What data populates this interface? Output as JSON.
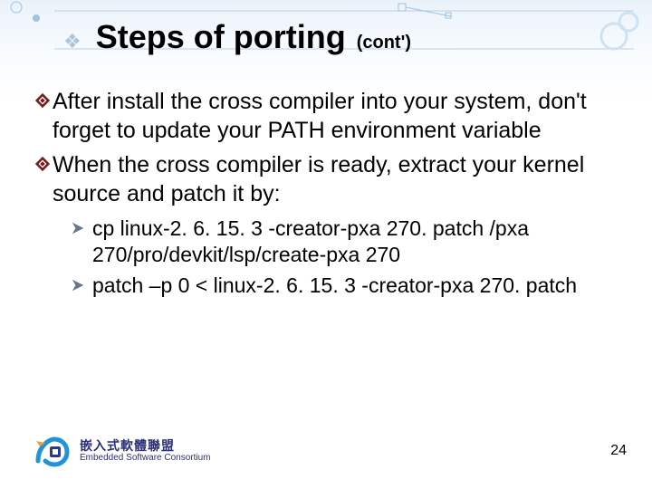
{
  "title": {
    "main": "Steps of porting",
    "suffix": "(cont')"
  },
  "bullets": [
    {
      "text": "After install the cross compiler into your system, don't forget to update your PATH environment variable"
    },
    {
      "text": "When the cross compiler is ready, extract your kernel source and patch it by:"
    }
  ],
  "sub_bullets": [
    {
      "text": "cp  linux-2. 6. 15. 3 -creator-pxa 270. patch /pxa 270/pro/devkit/lsp/create-pxa 270"
    },
    {
      "text": "patch –p 0 < linux-2. 6. 15. 3 -creator-pxa 270. patch"
    }
  ],
  "footer": {
    "org_cn": "嵌入式軟體聯盟",
    "org_en": "Embedded Software Consortium",
    "page_number": "24"
  }
}
